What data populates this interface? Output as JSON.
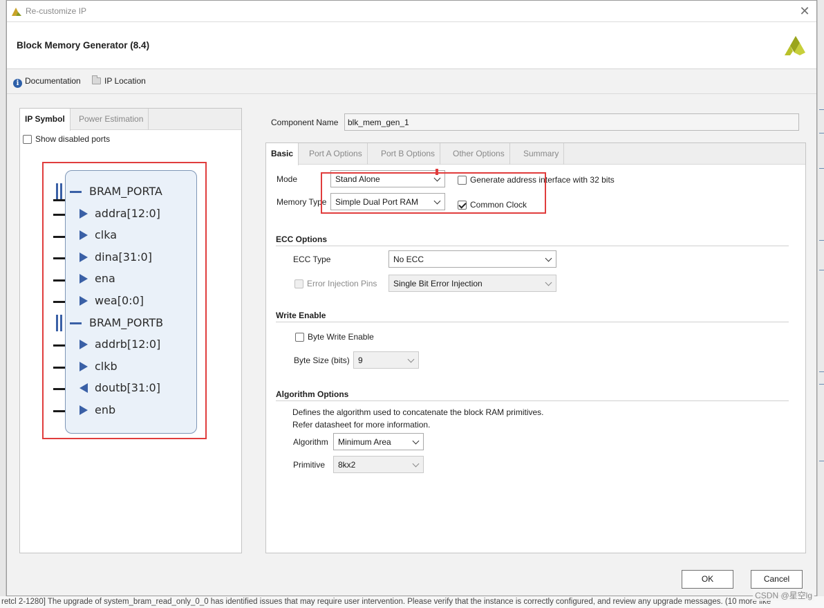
{
  "window": {
    "title": "Re-customize IP"
  },
  "header": {
    "heading": "Block Memory Generator (8.4)"
  },
  "links": {
    "documentation": "Documentation",
    "ip_location": "IP Location"
  },
  "left_panel": {
    "tabs": [
      "IP Symbol",
      "Power Estimation"
    ],
    "show_disabled_ports": "Show disabled ports",
    "symbol": {
      "porta": "BRAM_PORTA",
      "porta_pins": [
        "addra[12:0]",
        "clka",
        "dina[31:0]",
        "ena",
        "wea[0:0]"
      ],
      "portb": "BRAM_PORTB",
      "portb_pins": [
        "addrb[12:0]",
        "clkb",
        "doutb[31:0]",
        "enb"
      ]
    }
  },
  "component": {
    "label": "Component Name",
    "value": "blk_mem_gen_1"
  },
  "right_panel": {
    "tabs": [
      "Basic",
      "Port A Options",
      "Port B Options",
      "Other Options",
      "Summary"
    ],
    "mode_label": "Mode",
    "mode_value": "Stand Alone",
    "memory_type_label": "Memory Type",
    "memory_type_value": "Simple Dual Port RAM",
    "gen_addr_label": "Generate address interface with 32 bits",
    "common_clock_label": "Common Clock",
    "ecc_section": "ECC Options",
    "ecc_type_label": "ECC Type",
    "ecc_type_value": "No ECC",
    "error_injection_label": "Error Injection Pins",
    "error_injection_value": "Single Bit Error Injection",
    "write_enable_section": "Write Enable",
    "byte_write_enable_label": "Byte Write Enable",
    "byte_size_label": "Byte Size (bits)",
    "byte_size_value": "9",
    "algorithm_section": "Algorithm Options",
    "algorithm_desc_1": "Defines the algorithm used to concatenate the block RAM primitives.",
    "algorithm_desc_2": "Refer datasheet for more information.",
    "algorithm_label": "Algorithm",
    "algorithm_value": "Minimum Area",
    "primitive_label": "Primitive",
    "primitive_value": "8kx2"
  },
  "buttons": {
    "ok": "OK",
    "cancel": "Cancel"
  },
  "background": {
    "status_message": "retcl 2-1280] The upgrade of system_bram_read_only_0_0 has identified issues that may require user intervention. Please verify that the instance is correctly configured, and review any upgrade messages. (10 more like",
    "watermark": "CSDN @星空lg"
  },
  "colors": {
    "highlight_red": "#e03c3c",
    "symbol_fill": "#eaf1f9",
    "port_blue": "#3a60a6"
  }
}
